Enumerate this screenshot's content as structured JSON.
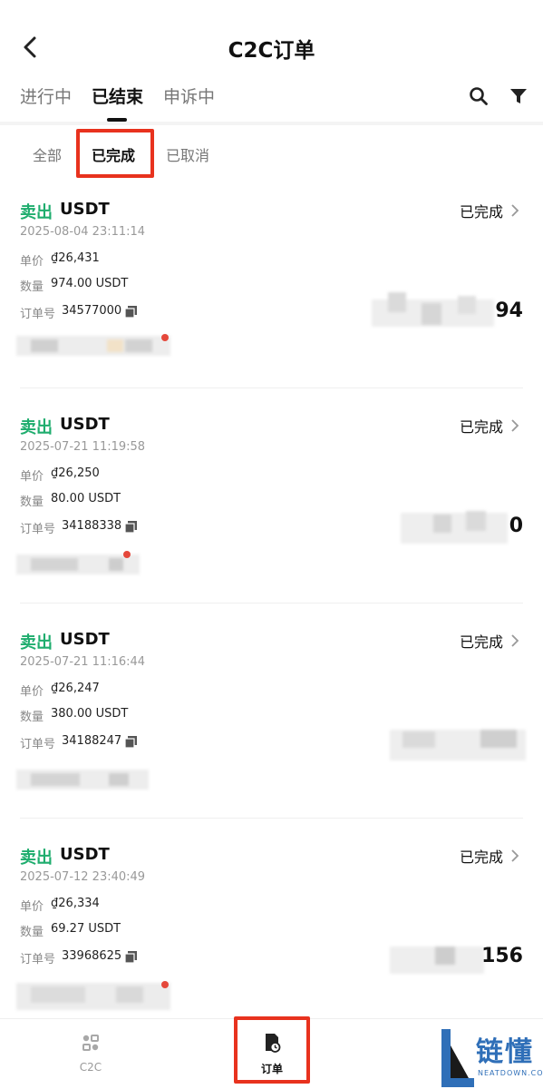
{
  "header": {
    "title": "C2C订单"
  },
  "tabs": [
    {
      "label": "进行中",
      "active": false
    },
    {
      "label": "已结束",
      "active": true
    },
    {
      "label": "申诉中",
      "active": false
    }
  ],
  "subtabs": [
    {
      "label": "全部",
      "active": false
    },
    {
      "label": "已完成",
      "active": true
    },
    {
      "label": "已取消",
      "active": false
    }
  ],
  "labels": {
    "price": "单价",
    "quantity": "数量",
    "order_no": "订单号"
  },
  "orders": [
    {
      "side": "卖出",
      "coin": "USDT",
      "time": "2025-08-04 23:11:14",
      "status": "已完成",
      "price": "₫26,431",
      "quantity": "974.00 USDT",
      "order_no": "34577000",
      "amount_tail": "94"
    },
    {
      "side": "卖出",
      "coin": "USDT",
      "time": "2025-07-21 11:19:58",
      "status": "已完成",
      "price": "₫26,250",
      "quantity": "80.00 USDT",
      "order_no": "34188338",
      "amount_tail": "0"
    },
    {
      "side": "卖出",
      "coin": "USDT",
      "time": "2025-07-21 11:16:44",
      "status": "已完成",
      "price": "₫26,247",
      "quantity": "380.00 USDT",
      "order_no": "34188247",
      "amount_tail": ""
    },
    {
      "side": "卖出",
      "coin": "USDT",
      "time": "2025-07-12 23:40:49",
      "status": "已完成",
      "price": "₫26,334",
      "quantity": "69.27 USDT",
      "order_no": "33968625",
      "amount_tail": "156"
    }
  ],
  "bottom_nav": [
    {
      "label": "C2C",
      "icon": "c2c-icon"
    },
    {
      "label": "订单",
      "icon": "order-clock-icon",
      "active": true
    }
  ],
  "watermark": {
    "text": "链懂",
    "sub": "NEATDOWN.COM"
  },
  "colors": {
    "sell": "#1fad6e",
    "highlight": "#e8321e",
    "watermark": "#2f6fb8"
  }
}
